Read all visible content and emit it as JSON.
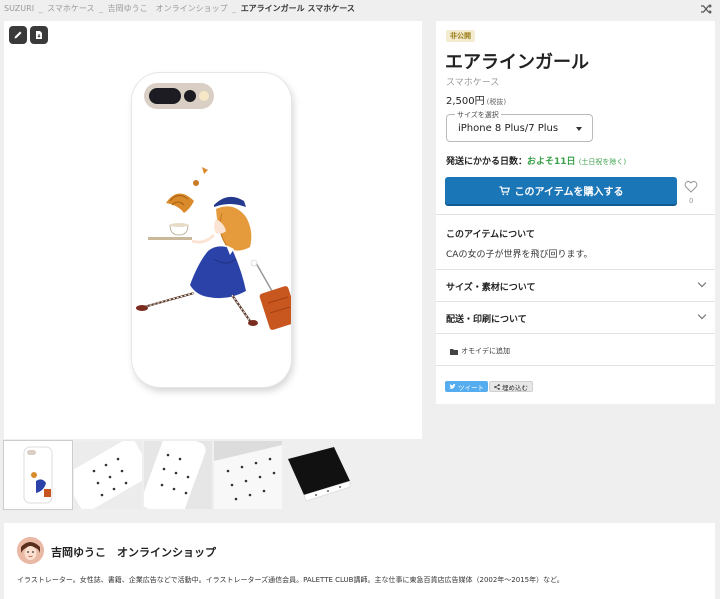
{
  "breadcrumb": {
    "items": [
      "SUZURI",
      "スマホケース",
      "吉岡ゆうこ　オンラインショップ"
    ],
    "separator": "_",
    "current": "エアラインガール スマホケース"
  },
  "product": {
    "badge": "非公開",
    "title": "エアラインガール",
    "category": "スマホケース",
    "price": "2,500円",
    "tax_note": "(税抜)",
    "size_label": "サイズを選択",
    "size_value": "iPhone 8 Plus/7 Plus",
    "shipping_label": "発送にかかる日数：",
    "shipping_days": "およそ11日",
    "shipping_note": "(土日祝を除く)",
    "buy_label": "このアイテムを購入する",
    "like_count": "0",
    "about_title": "このアイテムについて",
    "about_desc": "CAの女の子が世界を飛び回ります。",
    "size_section": "サイズ・素材について",
    "delivery_section": "配送・印刷について",
    "omoide_label": "オモイデに追加",
    "tweet_label": "ツイート",
    "embed_label": "埋め込む"
  },
  "shop": {
    "name": "吉岡ゆうこ　オンラインショップ",
    "description": "イラストレーター。女性誌、書籍、企業広告などで活動中。イラストレーターズ通信会員。PALETTE CLUB講師。主な仕事に東急百貨店広告媒体（2002年〜2015年）など。"
  },
  "colors": {
    "accent": "#1b76b8",
    "shipping_green": "#3aa14a",
    "badge_bg": "#f4ecd0"
  },
  "icons": [
    "shuffle-icon",
    "pencil-icon",
    "download-icon",
    "cart-icon",
    "heart-icon",
    "chevron-down-icon",
    "folder-icon",
    "twitter-icon",
    "share-icon"
  ]
}
